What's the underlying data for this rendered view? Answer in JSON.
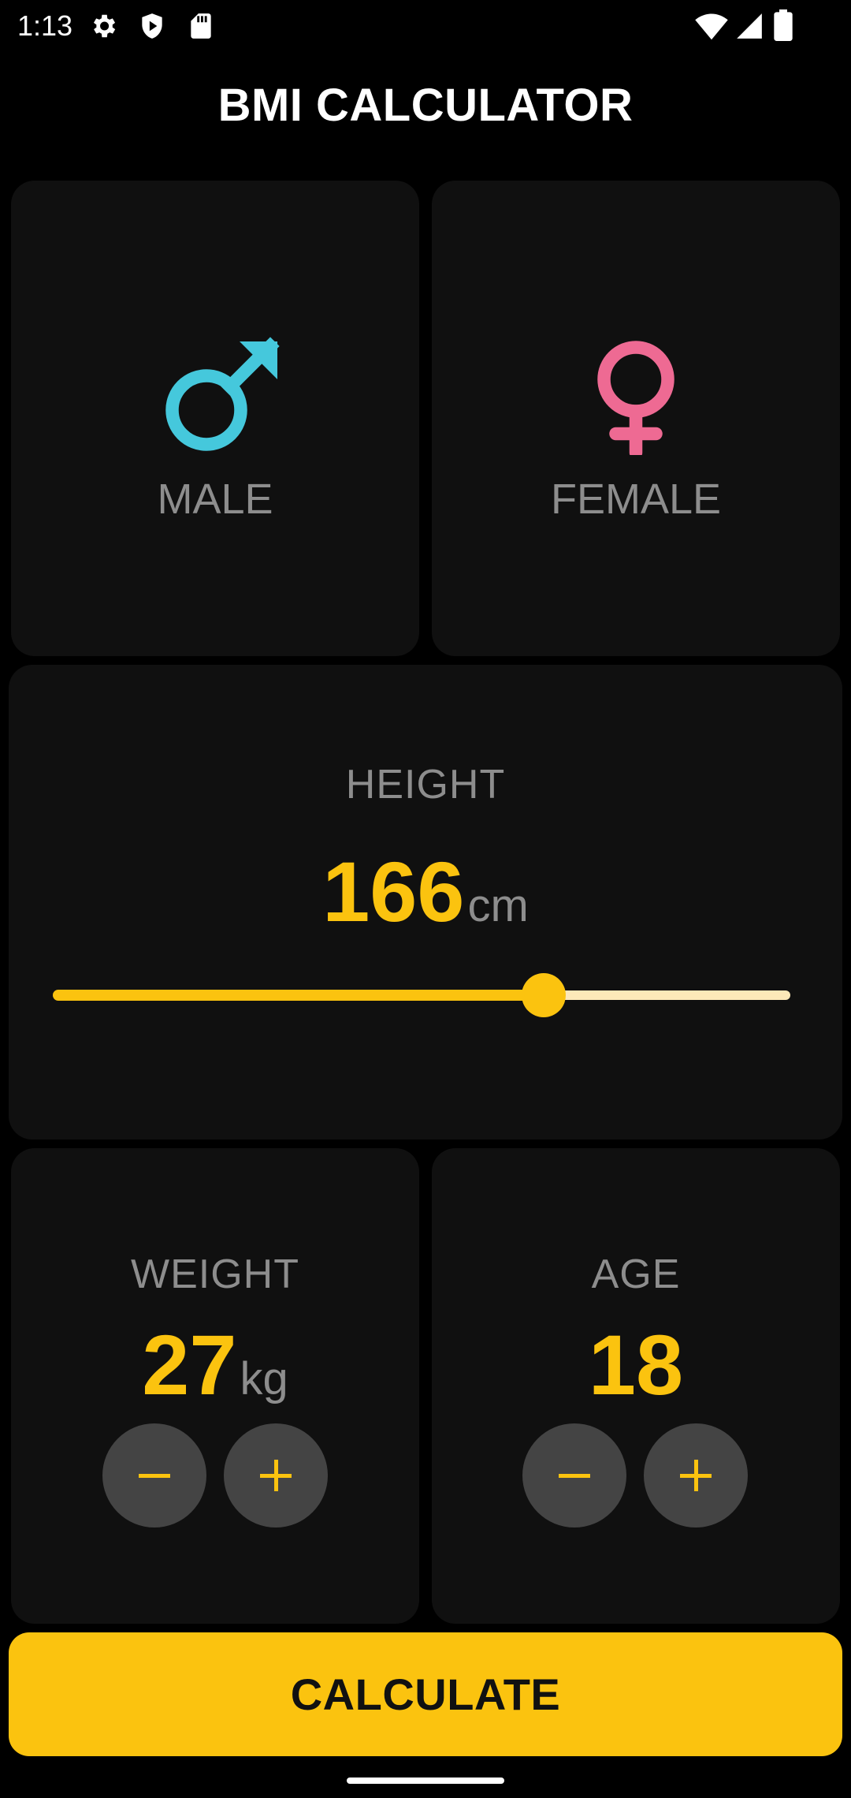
{
  "status_bar": {
    "time": "1:13",
    "left_icons": [
      "gear-icon",
      "shield-icon",
      "sd-card-icon"
    ],
    "right_icons": [
      "wifi-icon",
      "signal-icon",
      "battery-icon"
    ]
  },
  "app": {
    "title": "BMI CALCULATOR"
  },
  "gender": {
    "male_label": "MALE",
    "female_label": "FEMALE",
    "male_color": "#45c8dc",
    "female_color": "#ee6a93"
  },
  "height": {
    "label": "HEIGHT",
    "value": "166",
    "unit": "cm",
    "slider_fraction": 0.66
  },
  "weight": {
    "label": "WEIGHT",
    "value": "27",
    "unit": "kg"
  },
  "age": {
    "label": "AGE",
    "value": "18"
  },
  "actions": {
    "calculate_label": "CALCULATE"
  },
  "colors": {
    "accent": "#fbc30f",
    "card": "#101010",
    "background": "#000000",
    "button": "#444444",
    "muted_text": "#8d8d8d"
  }
}
